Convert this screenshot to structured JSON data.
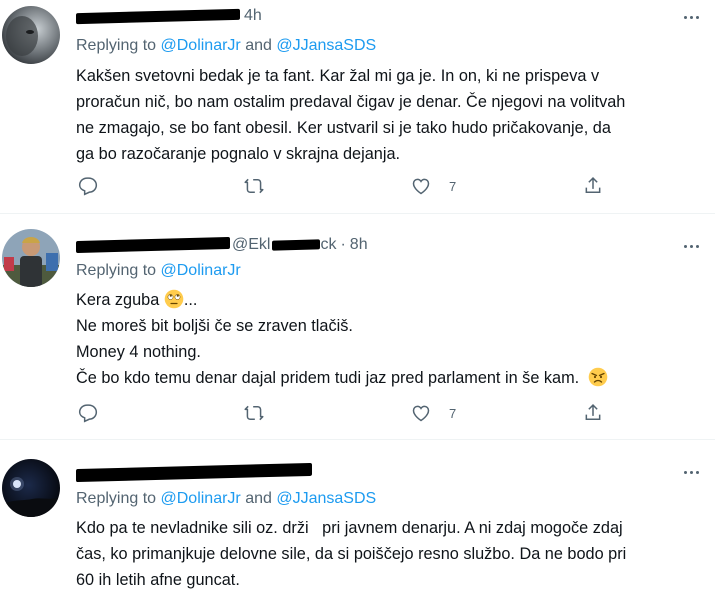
{
  "tweets": [
    {
      "time": "4h",
      "replying_prefix": "Replying to ",
      "replying_users": [
        "@DolinarJr",
        "@JJansaSDS"
      ],
      "replying_and": " and ",
      "lines": [
        "Kakšen svetovni bedak je ta fant. Kar žal mi ga je. In on, ki ne prispeva v",
        "proračun nič, bo nam ostalim predaval čigav je denar. Če njegovi na volitvah",
        "ne zmagajo, se bo fant obesil. Ker ustvaril si je tako hudo pričakovanje, da",
        "ga bo razočaranje pognalo v skrajna dejanja."
      ],
      "like_count": "7"
    },
    {
      "time": "8h",
      "header_fragment": "@Ekl",
      "header_fragment2": "ck",
      "replying_prefix": "Replying to ",
      "replying_users": [
        "@DolinarJr"
      ],
      "line1": "Kera zguba",
      "line1_suffix": "...",
      "line2": "Ne moreš bit boljši če se zraven tlačiš.",
      "line3": "Money 4 nothing.",
      "line4": "Če bo kdo temu denar dajal pridem tudi jaz pred parlament in še kam.",
      "like_count": "7"
    },
    {
      "replying_prefix": "Replying to ",
      "replying_users": [
        "@DolinarJr",
        "@JJansaSDS"
      ],
      "replying_and": " and ",
      "lines": [
        "Kdo pa te nevladnike sili oz. drži   pri javnem denarju. A ni zdaj mogoče zdaj",
        "čas, ko primanjkuje delovne sile, da si poiščejo resno službo. Da ne bodo pri",
        "60 ih letih afne guncat."
      ]
    }
  ],
  "icons": {
    "reply": "reply-icon",
    "retweet": "retweet-icon",
    "like": "heart-icon",
    "share": "share-icon",
    "more": "more-icon",
    "emoji1": "rolling-eyes-emoji",
    "emoji2": "angry-face-emoji"
  },
  "colors": {
    "link": "#1d9bf0",
    "secondary": "#536471",
    "text": "#0f1419"
  }
}
